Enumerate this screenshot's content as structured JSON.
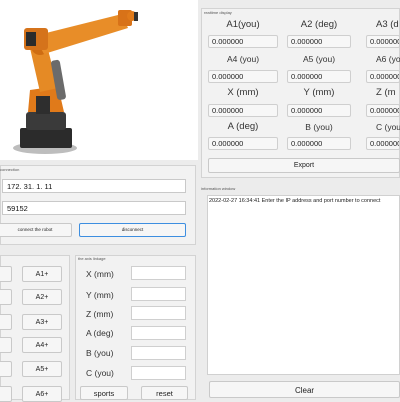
{
  "sections": {
    "readout_title": "realtime display",
    "connection_title": "connection",
    "info_title": "information window",
    "linkage_title": "the axis linkage"
  },
  "readout": {
    "rows": [
      {
        "labels": [
          "A1(you)",
          "A2 (deg)",
          "A3 (d"
        ],
        "values": [
          "0.000000",
          "0.000000",
          "0.000000"
        ]
      },
      {
        "labels": [
          "A4 (you)",
          "A5 (you)",
          "A6 (yo"
        ],
        "values": [
          "0.000000",
          "0.000000",
          "0.000000"
        ]
      },
      {
        "labels": [
          "X (mm)",
          "Y (mm)",
          "Z (m"
        ],
        "values": [
          "0.000000",
          "0.000000",
          "0.000000"
        ]
      },
      {
        "labels": [
          "A (deg)",
          "B (you)",
          "C (you"
        ],
        "values": [
          "0.000000",
          "0.000000",
          "0.000000"
        ]
      }
    ],
    "export_label": "Export"
  },
  "connection": {
    "ip": "172. 31. 1. 11",
    "port": "59152",
    "connect_label": "connect the robot",
    "disconnect_label": "disconnect"
  },
  "info": {
    "log": "2022-02-27 16:34:41 Enter the IP address and port number to connect",
    "clear_label": "Clear"
  },
  "jog": {
    "plus_labels": [
      "A1+",
      "A2+",
      "A3+",
      "A4+",
      "A5+",
      "A6+"
    ]
  },
  "linkage": {
    "labels": [
      "X (mm)",
      "Y (mm)",
      "Z (mm)",
      "A (deg)",
      "B (you)",
      "C (you)"
    ],
    "sports_label": "sports",
    "reset_label": "reset"
  },
  "colors": {
    "robot": "#e07a1a",
    "accent": "#3d8ee0"
  }
}
